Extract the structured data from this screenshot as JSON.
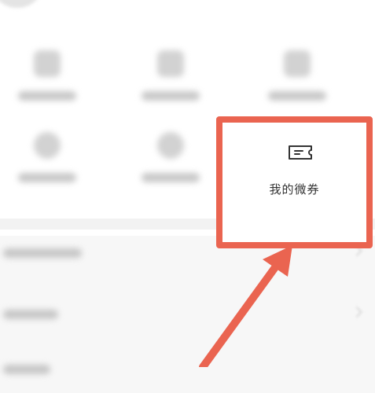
{
  "highlighted_item": {
    "label": "我的微券",
    "icon": "ticket-icon"
  },
  "blurred_grid_icons": [
    "document-icon",
    "box-icon",
    "bag-icon",
    "clock-icon",
    "person-icon"
  ],
  "colors": {
    "highlight": "#ea6450",
    "label_text": "#333333"
  }
}
